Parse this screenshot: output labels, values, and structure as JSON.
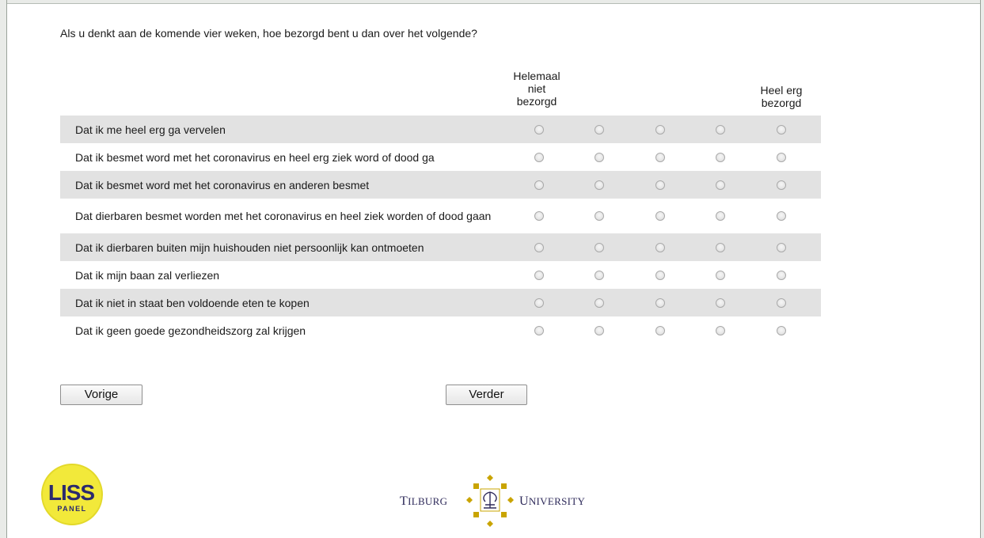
{
  "question": "Als u denkt aan de komende vier weken, hoe bezorgd bent u dan over het volgende?",
  "scale": {
    "left_label_lines": [
      "Helemaal",
      "niet",
      "bezorgd"
    ],
    "right_label_lines": [
      "Heel erg",
      "bezorgd"
    ]
  },
  "items": [
    "Dat ik me heel erg ga vervelen",
    "Dat ik besmet word met het coronavirus en heel erg ziek word of dood ga",
    "Dat ik besmet word met het coronavirus en anderen besmet",
    "Dat dierbaren besmet worden met het coronavirus en heel ziek worden of dood gaan",
    "Dat ik dierbaren buiten mijn huishouden niet persoonlijk kan ontmoeten",
    "Dat ik mijn baan zal verliezen",
    "Dat ik niet in staat ben voldoende eten te kopen",
    "Dat ik geen goede gezondheidszorg zal krijgen"
  ],
  "buttons": {
    "previous": "Vorige",
    "next": "Verder"
  },
  "logos": {
    "liss_line1": "LISS",
    "liss_line2": "PANEL",
    "tilburg_left": "Tilburg",
    "tilburg_right": "University"
  },
  "colors": {
    "row_shade": "#e2e2e2",
    "liss_yellow": "#f2e93a",
    "liss_navy": "#2b2a6e",
    "tilburg_gold": "#c9a400"
  }
}
